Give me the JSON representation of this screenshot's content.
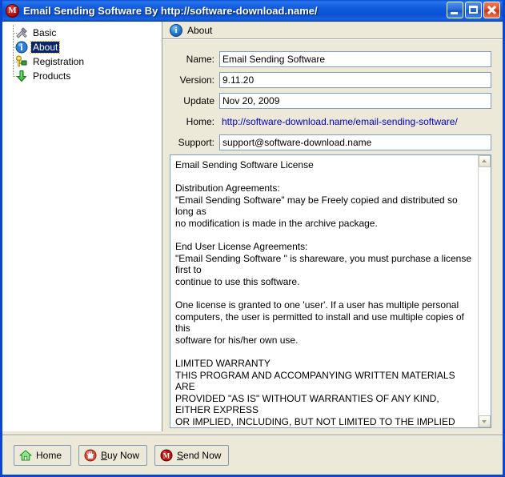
{
  "window": {
    "title": "Email Sending Software  By http://software-download.name/",
    "icon": "app-m-icon",
    "controls": {
      "minimize": "Minimize",
      "maximize": "Maximize",
      "close": "Close"
    }
  },
  "sidebar": {
    "items": [
      {
        "label": "Basic",
        "icon": "tools-icon",
        "selected": false
      },
      {
        "label": "About",
        "icon": "info-icon",
        "selected": true
      },
      {
        "label": "Registration",
        "icon": "key-icon",
        "selected": false
      },
      {
        "label": "Products",
        "icon": "down-arrow-icon",
        "selected": false
      }
    ]
  },
  "content": {
    "header": {
      "icon": "info-icon",
      "label": "About"
    },
    "fields": [
      {
        "label": "Name:",
        "value": "Email Sending Software",
        "type": "text"
      },
      {
        "label": "Version:",
        "value": "9.11.20",
        "type": "text"
      },
      {
        "label": "Update",
        "value": "Nov 20, 2009",
        "type": "text"
      },
      {
        "label": "Home:",
        "value": "http://software-download.name/email-sending-software/",
        "type": "link"
      },
      {
        "label": "Support:",
        "value": "support@software-download.name",
        "type": "text"
      }
    ],
    "license": "Email Sending Software License\n\nDistribution Agreements:\n\"Email Sending Software\" may be Freely copied and distributed so long as\nno modification is made in the archive package.\n\nEnd User License Agreements:\n\"Email Sending Software \" is shareware, you must purchase a license first to\ncontinue to use this software.\n\nOne license is granted to one 'user'. If a user has multiple personal\ncomputers, the user is permitted to install and use multiple copies of this\nsoftware for his/her own use.\n\nLIMITED WARRANTY\nTHIS PROGRAM AND ACCOMPANYING WRITTEN MATERIALS ARE\nPROVIDED \"AS IS\" WITHOUT WARRANTIES OF ANY KIND, EITHER EXPRESS\nOR IMPLIED, INCLUDING, BUT NOT LIMITED TO THE IMPLIED WARRANTIES\nOF MERCHANTABILITY OR FITNESS FOR A PARTICULAR PURPOSE.\n\nCOPYRIGHT\nEmail Sending Software application is owned and licensed exclusively by\nSoftware Download, Inc.\nCopyright (C) 2008 http://software-download.name/ , Inc. All rights\nreserved.\nReverse-engineering or modifying this software is strictly prohibited.",
    "scrollbar": {
      "up": "Scroll up",
      "down": "Scroll down"
    }
  },
  "footer": {
    "buttons": [
      {
        "label": "Home",
        "icon": "house-icon",
        "accesskey": ""
      },
      {
        "label": "Buy Now",
        "icon": "cart-icon",
        "accesskey": "B"
      },
      {
        "label": "Send Now",
        "icon": "app-m-icon",
        "accesskey": "S"
      }
    ]
  },
  "colors": {
    "titlebar_blue": "#0a51d6",
    "panel_beige": "#ece9d8",
    "selection_blue": "#0a246a",
    "link_blue": "#0000cc",
    "field_border": "#7f9db9"
  }
}
